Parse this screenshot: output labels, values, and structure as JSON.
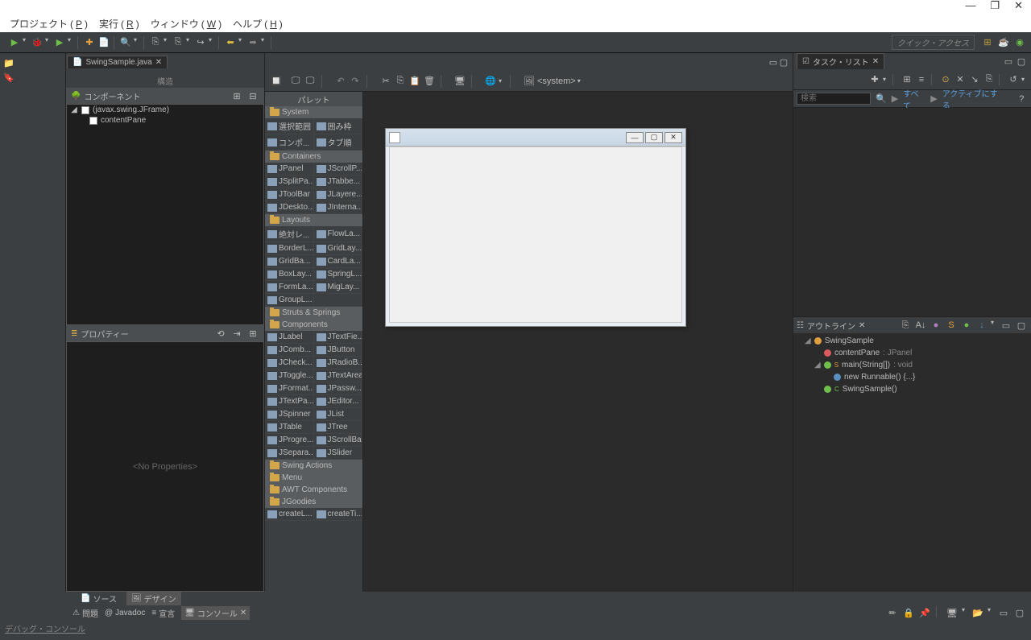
{
  "titlebar": {
    "win_min": "—",
    "win_max": "❐",
    "win_close": "✕"
  },
  "menubar": {
    "project": "プロジェクト",
    "project_mn": "P",
    "run": "実行",
    "run_mn": "R",
    "window": "ウィンドウ",
    "window_mn": "W",
    "help": "ヘルプ",
    "help_mn": "H"
  },
  "toolbar": {
    "quick_access": "クイック・アクセス"
  },
  "editor": {
    "tab_file": "SwingSample.java",
    "breadcrumb": "構造",
    "system_label": "<system>",
    "palette_title": "パレット",
    "source_tab": "ソース",
    "design_tab": "デザイン",
    "status_hint": "",
    "structure_panel": "コンポーネント",
    "properties_panel": "プロパティー",
    "no_properties": "<No Properties>"
  },
  "structure": {
    "root": "(javax.swing.JFrame)",
    "child": "contentPane"
  },
  "palette": {
    "cat_system": "System",
    "sys_items": [
      [
        "選択範囲",
        "囲み枠"
      ],
      [
        "コンポ...",
        "タブ順"
      ]
    ],
    "cat_containers": "Containers",
    "containers": [
      [
        "JPanel",
        "JScrollP..."
      ],
      [
        "JSplitPa...",
        "JTabbe..."
      ],
      [
        "JToolBar",
        "JLayere..."
      ],
      [
        "JDeskto...",
        "JInterna..."
      ]
    ],
    "cat_layouts": "Layouts",
    "layouts": [
      [
        "絶対レ...",
        "FlowLa..."
      ],
      [
        "BorderL...",
        "GridLay..."
      ],
      [
        "GridBa...",
        "CardLa..."
      ],
      [
        "BoxLay...",
        "SpringL..."
      ],
      [
        "FormLa...",
        "MigLay..."
      ],
      [
        "GroupL...",
        ""
      ]
    ],
    "cat_struts": "Struts & Springs",
    "cat_components": "Components",
    "components": [
      [
        "JLabel",
        "JTextFie..."
      ],
      [
        "JComb...",
        "JButton"
      ],
      [
        "JCheck...",
        "JRadioB..."
      ],
      [
        "JToggle...",
        "JTextArea"
      ],
      [
        "JFormat...",
        "JPassw..."
      ],
      [
        "JTextPa...",
        "JEditor..."
      ],
      [
        "JSpinner",
        "JList"
      ],
      [
        "JTable",
        "JTree"
      ],
      [
        "JProgre...",
        "JScrollBar"
      ],
      [
        "JSepara...",
        "JSlider"
      ]
    ],
    "cat_swingactions": "Swing Actions",
    "cat_menu": "Menu",
    "cat_awt": "AWT Components",
    "cat_jgoodies": "JGoodies",
    "jgoodies": [
      [
        "createL...",
        "createTi..."
      ]
    ]
  },
  "tasklist": {
    "title": "タスク・リスト",
    "search_ph": "検索",
    "all": "すべて",
    "activate": "アクティブにする..."
  },
  "outline": {
    "title": "アウトライン",
    "root": "SwingSample",
    "field": "contentPane",
    "field_type": ": JPanel",
    "main": "main(String[])",
    "main_ret": " : void",
    "runnable": "new Runnable() {...}",
    "ctor": "SwingSample()"
  },
  "bottom": {
    "problems": "問題",
    "javadoc": "Javadoc",
    "decl": "宣言",
    "console": "コンソール",
    "debug_console": "デバッグ・コンソール"
  }
}
